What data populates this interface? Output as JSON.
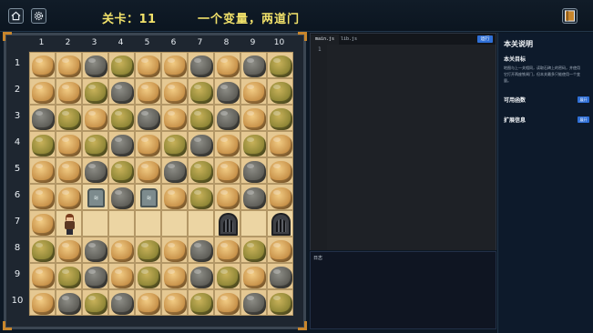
{
  "header": {
    "level_text": "关卡：11",
    "title": "一个变量，两道门",
    "home_icon": "home-icon",
    "settings_icon": "gear-icon",
    "guide_icon": "book-icon"
  },
  "board": {
    "columns": [
      "1",
      "2",
      "3",
      "4",
      "5",
      "6",
      "7",
      "8",
      "9",
      "10"
    ],
    "rows": [
      "1",
      "2",
      "3",
      "4",
      "5",
      "6",
      "7",
      "8",
      "9",
      "10"
    ],
    "legend": {
      "s": "sand-rock",
      "g": "grey-rock",
      "m": "moss-rock",
      "f": "floor",
      "t": "stone-tablet",
      "d": "iron-gate",
      "h": "hero"
    },
    "tiles": [
      "ssgmssgsgm",
      "ssmgssmgsm",
      "gmsmgsmgsm",
      "msmgsmgsms",
      "ssgmsgmsgs",
      "sstgtsmsgs",
      "shfffffdfd",
      "msgsmsgsms",
      "smgsmsgmsg",
      "sgmgssmsgm"
    ],
    "tablet_glyph": "≋"
  },
  "editor": {
    "tabs": [
      "main.js",
      "lib.js"
    ],
    "run_label": "运行",
    "line_number": "1"
  },
  "output": {
    "label": "日志"
  },
  "info": {
    "title": "本关说明",
    "goal_title": "本关目标",
    "goal_desc": "地图与上一关相同，读取石碑上的密码，并使用它打开两座铁闸门，但本关最多只能使用一个变量。",
    "rows": [
      {
        "label": "可用函数",
        "button": "展开"
      },
      {
        "label": "扩展信息",
        "button": "展开"
      }
    ]
  },
  "colors": {
    "accent": "#f2e26a",
    "frame_corner": "#c8862c",
    "run_button": "#2f6fd6"
  }
}
